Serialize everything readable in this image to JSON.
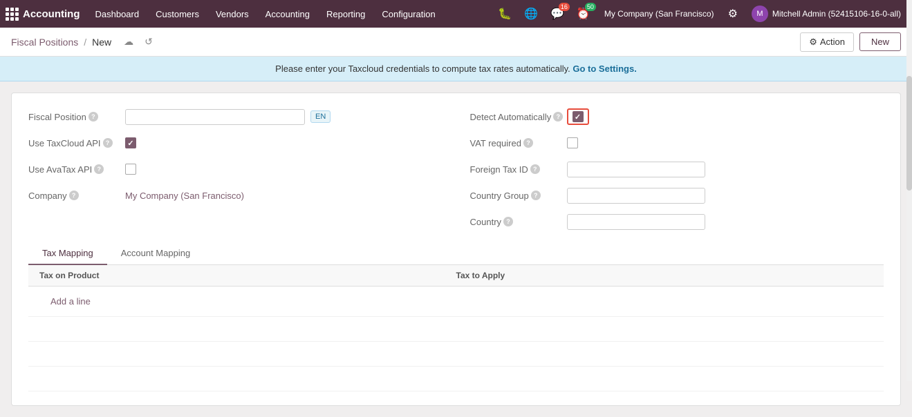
{
  "app": {
    "name": "Accounting"
  },
  "navbar": {
    "items": [
      {
        "id": "dashboard",
        "label": "Dashboard"
      },
      {
        "id": "customers",
        "label": "Customers"
      },
      {
        "id": "vendors",
        "label": "Vendors"
      },
      {
        "id": "accounting",
        "label": "Accounting"
      },
      {
        "id": "reporting",
        "label": "Reporting"
      },
      {
        "id": "configuration",
        "label": "Configuration"
      }
    ],
    "icons": {
      "bug": "🐛",
      "globe": "🌐",
      "chat_count": "16",
      "activity_count": "50"
    },
    "company": "My Company (San Francisco)",
    "user": "Mitchell Admin (52415106-16-0-all)"
  },
  "breadcrumb": {
    "parent": "Fiscal Positions",
    "sep": "/",
    "current": "New",
    "save_icon": "☁",
    "undo_icon": "↺"
  },
  "toolbar": {
    "action_label": "Action",
    "new_label": "New"
  },
  "banner": {
    "text": "Please enter your Taxcloud credentials to compute tax rates automatically.",
    "link_text": "Go to Settings."
  },
  "form": {
    "fiscal_position_label": "Fiscal Position",
    "lang_badge": "EN",
    "use_taxcloud_label": "Use TaxCloud API",
    "use_taxcloud_checked": true,
    "use_avatax_label": "Use AvaTax API",
    "use_avatax_checked": false,
    "company_label": "Company",
    "company_value": "My Company (San Francisco)",
    "detect_auto_label": "Detect Automatically",
    "detect_auto_checked": true,
    "vat_required_label": "VAT required",
    "vat_required_checked": false,
    "foreign_tax_id_label": "Foreign Tax ID",
    "country_group_label": "Country Group",
    "country_label": "Country"
  },
  "tabs": [
    {
      "id": "tax-mapping",
      "label": "Tax Mapping",
      "active": true
    },
    {
      "id": "account-mapping",
      "label": "Account Mapping",
      "active": false
    }
  ],
  "table": {
    "col1": "Tax on Product",
    "col2": "Tax to Apply",
    "add_line": "Add a line"
  }
}
